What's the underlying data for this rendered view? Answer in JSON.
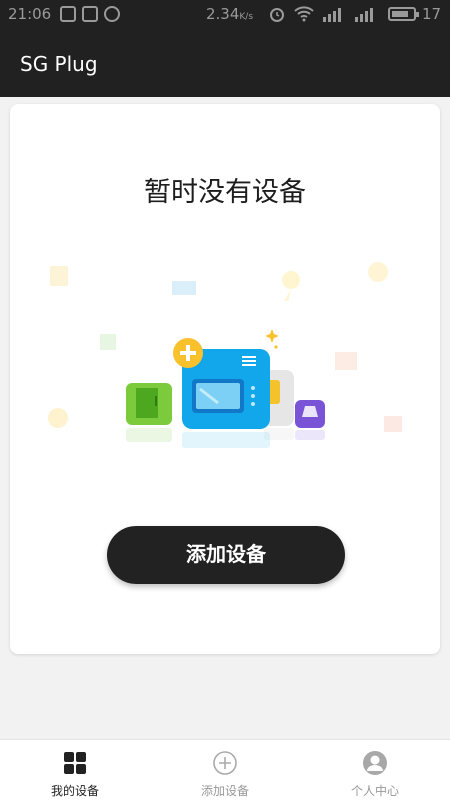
{
  "status_bar": {
    "time": "21:06",
    "speed_value": "2.34",
    "speed_unit": "K/s",
    "battery": "17"
  },
  "app_bar": {
    "title": "SG Plug"
  },
  "empty_state": {
    "title": "暂时没有设备",
    "button_label": "添加设备"
  },
  "bottom_nav": [
    {
      "label": "我的设备",
      "icon": "grid-icon",
      "active": true
    },
    {
      "label": "添加设备",
      "icon": "add-circle-icon",
      "active": false
    },
    {
      "label": "个人中心",
      "icon": "user-icon",
      "active": false
    }
  ],
  "colors": {
    "header": "#212121",
    "button": "#222222",
    "active_nav": "#222222",
    "inactive_nav": "#999999"
  }
}
